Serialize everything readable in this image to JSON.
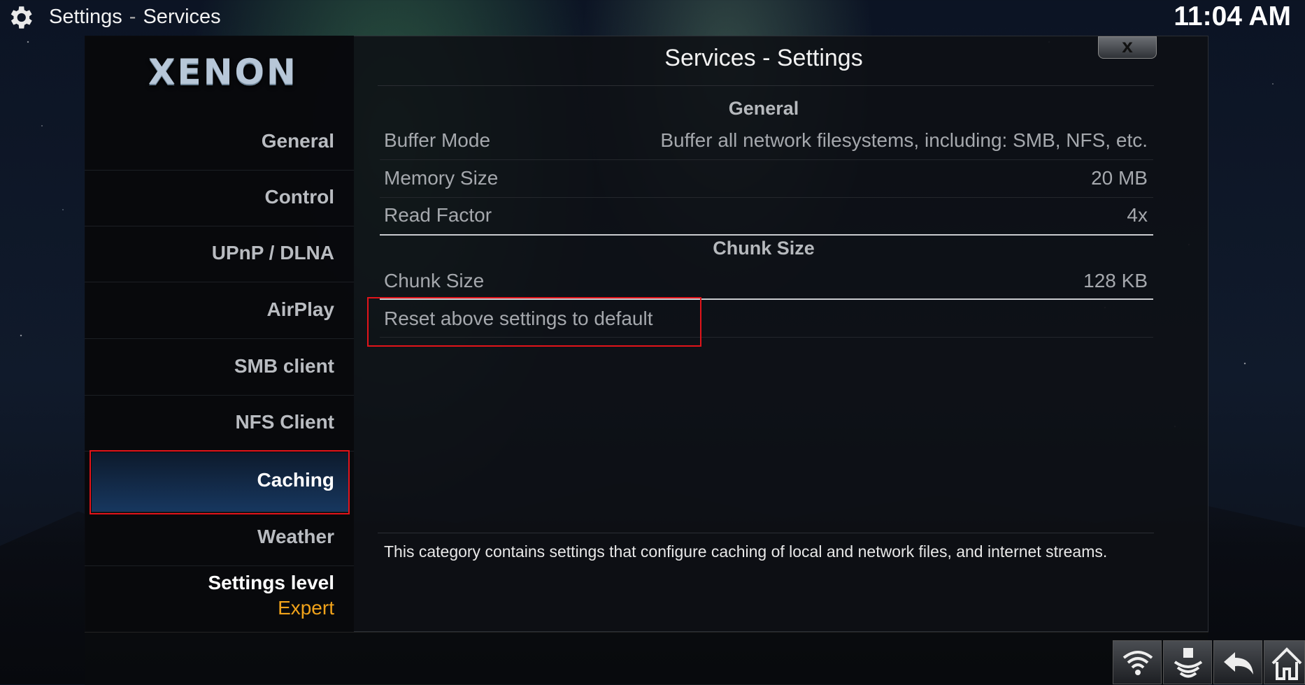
{
  "header": {
    "breadcrumb_root": "Settings",
    "breadcrumb_separator": "-",
    "breadcrumb_section": "Services",
    "clock": "11:04 AM"
  },
  "logo": {
    "text": "XENON"
  },
  "sidebar": {
    "items": [
      {
        "label": "General"
      },
      {
        "label": "Control"
      },
      {
        "label": "UPnP / DLNA"
      },
      {
        "label": "AirPlay"
      },
      {
        "label": "SMB client"
      },
      {
        "label": "NFS Client"
      },
      {
        "label": "Caching",
        "active": true
      },
      {
        "label": "Weather"
      }
    ],
    "settings_level_label": "Settings level",
    "settings_level_value": "Expert"
  },
  "dialog": {
    "title": "Services - Settings",
    "close_label": "x",
    "groups": [
      {
        "heading": "General",
        "rows": [
          {
            "label": "Buffer Mode",
            "value": "Buffer all network filesystems, including: SMB, NFS, etc."
          },
          {
            "label": "Memory Size",
            "value": "20 MB"
          },
          {
            "label": "Read Factor",
            "value": "4x"
          }
        ]
      },
      {
        "heading": "Chunk Size",
        "rows": [
          {
            "label": "Chunk Size",
            "value": "128 KB"
          }
        ]
      }
    ],
    "reset_label": "Reset above settings to default",
    "description": "This category contains settings that configure caching of local and network files, and internet streams."
  },
  "footer_buttons": [
    "wifi-icon",
    "eject-icon",
    "back-icon",
    "home-icon"
  ],
  "colors": {
    "accent_orange": "#f0a21a",
    "highlight_red": "#e2141a",
    "active_blue": "#17375f"
  }
}
